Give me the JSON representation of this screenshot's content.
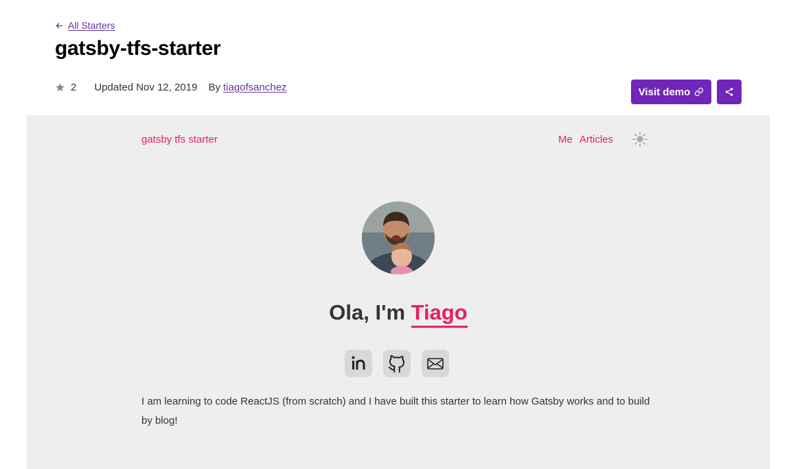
{
  "back_link": {
    "label": "All Starters"
  },
  "title": "gatsby-tfs-starter",
  "meta": {
    "stars": "2",
    "updated": "Updated Nov 12, 2019",
    "by": "By",
    "author": "tiagofsanchez"
  },
  "actions": {
    "visit_demo": "Visit demo"
  },
  "preview": {
    "brand": "gatsby tfs starter",
    "nav": [
      "Me",
      "Articles"
    ],
    "greeting_prefix": "Ola, I'm ",
    "greeting_name": "Tiago",
    "bio": "I am learning to code ReactJS (from scratch) and I have built this starter to learn how Gatsby works and to build by blog!"
  },
  "colors": {
    "accent": "#663399",
    "button": "#7026b9",
    "preview_accent": "#e91e63",
    "preview_bg": "#eeeeee"
  }
}
